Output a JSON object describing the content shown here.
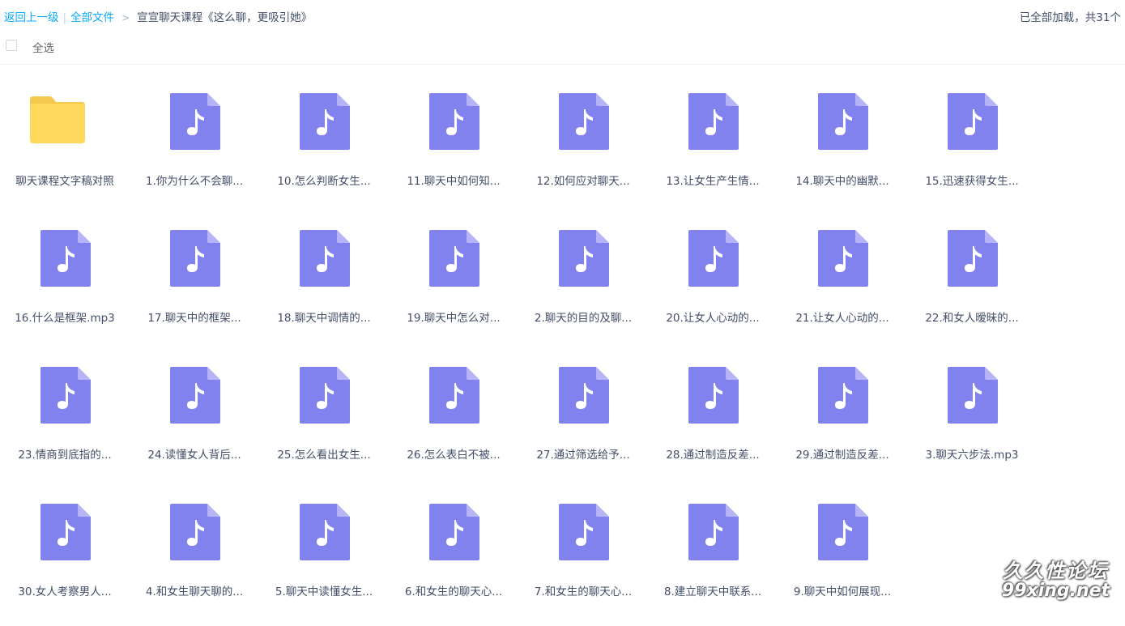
{
  "breadcrumb": {
    "back": "返回上一级",
    "root": "全部文件",
    "current": "宣宣聊天课程《这么聊，更吸引她》"
  },
  "status": {
    "loaded": "已全部加载，共31个"
  },
  "toolbar": {
    "select_all": "全选"
  },
  "colors": {
    "audio_icon": "#8282ee",
    "audio_fold": "#b4b4f7",
    "folder_back": "#f2c94c",
    "folder_front": "#ffd95c",
    "link": "#09aaff"
  },
  "files": [
    {
      "name": "聊天课程文字稿对照",
      "type": "folder",
      "icon": "folder-icon"
    },
    {
      "name": "1.你为什么不会聊...",
      "type": "audio",
      "icon": "music-note-icon"
    },
    {
      "name": "10.怎么判断女生...",
      "type": "audio",
      "icon": "music-note-icon"
    },
    {
      "name": "11.聊天中如何知...",
      "type": "audio",
      "icon": "music-note-icon"
    },
    {
      "name": "12.如何应对聊天...",
      "type": "audio",
      "icon": "music-note-icon"
    },
    {
      "name": "13.让女生产生情...",
      "type": "audio",
      "icon": "music-note-icon"
    },
    {
      "name": "14.聊天中的幽默...",
      "type": "audio",
      "icon": "music-note-icon"
    },
    {
      "name": "15.迅速获得女生...",
      "type": "audio",
      "icon": "music-note-icon"
    },
    {
      "name": "16.什么是框架.mp3",
      "type": "audio",
      "icon": "music-note-icon"
    },
    {
      "name": "17.聊天中的框架...",
      "type": "audio",
      "icon": "music-note-icon"
    },
    {
      "name": "18.聊天中调情的...",
      "type": "audio",
      "icon": "music-note-icon"
    },
    {
      "name": "19.聊天中怎么对...",
      "type": "audio",
      "icon": "music-note-icon"
    },
    {
      "name": "2.聊天的目的及聊...",
      "type": "audio",
      "icon": "music-note-icon"
    },
    {
      "name": "20.让女人心动的...",
      "type": "audio",
      "icon": "music-note-icon"
    },
    {
      "name": "21.让女人心动的...",
      "type": "audio",
      "icon": "music-note-icon"
    },
    {
      "name": "22.和女人暧昧的...",
      "type": "audio",
      "icon": "music-note-icon"
    },
    {
      "name": "23.情商到底指的...",
      "type": "audio",
      "icon": "music-note-icon"
    },
    {
      "name": "24.读懂女人背后...",
      "type": "audio",
      "icon": "music-note-icon"
    },
    {
      "name": "25.怎么看出女生...",
      "type": "audio",
      "icon": "music-note-icon"
    },
    {
      "name": "26.怎么表白不被...",
      "type": "audio",
      "icon": "music-note-icon"
    },
    {
      "name": "27.通过筛选给予...",
      "type": "audio",
      "icon": "music-note-icon"
    },
    {
      "name": "28.通过制造反差...",
      "type": "audio",
      "icon": "music-note-icon"
    },
    {
      "name": "29.通过制造反差...",
      "type": "audio",
      "icon": "music-note-icon"
    },
    {
      "name": "3.聊天六步法.mp3",
      "type": "audio",
      "icon": "music-note-icon"
    },
    {
      "name": "30.女人考察男人...",
      "type": "audio",
      "icon": "music-note-icon"
    },
    {
      "name": "4.和女生聊天聊的...",
      "type": "audio",
      "icon": "music-note-icon"
    },
    {
      "name": "5.聊天中读懂女生...",
      "type": "audio",
      "icon": "music-note-icon"
    },
    {
      "name": "6.和女生的聊天心...",
      "type": "audio",
      "icon": "music-note-icon"
    },
    {
      "name": "7.和女生的聊天心...",
      "type": "audio",
      "icon": "music-note-icon"
    },
    {
      "name": "8.建立聊天中联系...",
      "type": "audio",
      "icon": "music-note-icon"
    },
    {
      "name": "9.聊天中如何展现...",
      "type": "audio",
      "icon": "music-note-icon"
    }
  ],
  "watermark": {
    "line1": "久久性论坛",
    "line2": "99xing.net"
  }
}
